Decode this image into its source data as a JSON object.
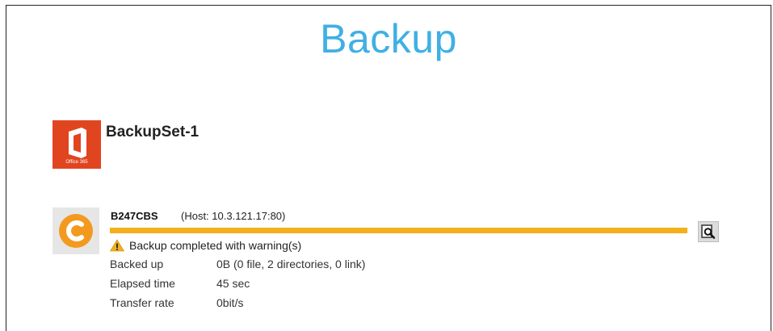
{
  "page": {
    "title": "Backup"
  },
  "backup_set": {
    "name": "BackupSet-1",
    "icon": "office-365-icon",
    "icon_caption": "Office 365",
    "icon_color": "#e1451f"
  },
  "destination": {
    "name": "B247CBS",
    "host": "(Host: 10.3.121.17:80)",
    "icon": "cbs-destination-icon",
    "icon_color": "#f39a1e"
  },
  "progress": {
    "percent": 100,
    "color": "#f4b01b"
  },
  "status": {
    "icon": "warning-icon",
    "text": "Backup completed with warning(s)"
  },
  "stats": [
    {
      "label": "Backed up",
      "value": "0B (0 file, 2 directories, 0 link)"
    },
    {
      "label": "Elapsed time",
      "value": "45 sec"
    },
    {
      "label": "Transfer rate",
      "value": "0bit/s"
    }
  ],
  "detail_button": {
    "icon": "magnifier-report-icon"
  },
  "colors": {
    "title": "#3fb0e3",
    "warning": "#f4b01b"
  }
}
